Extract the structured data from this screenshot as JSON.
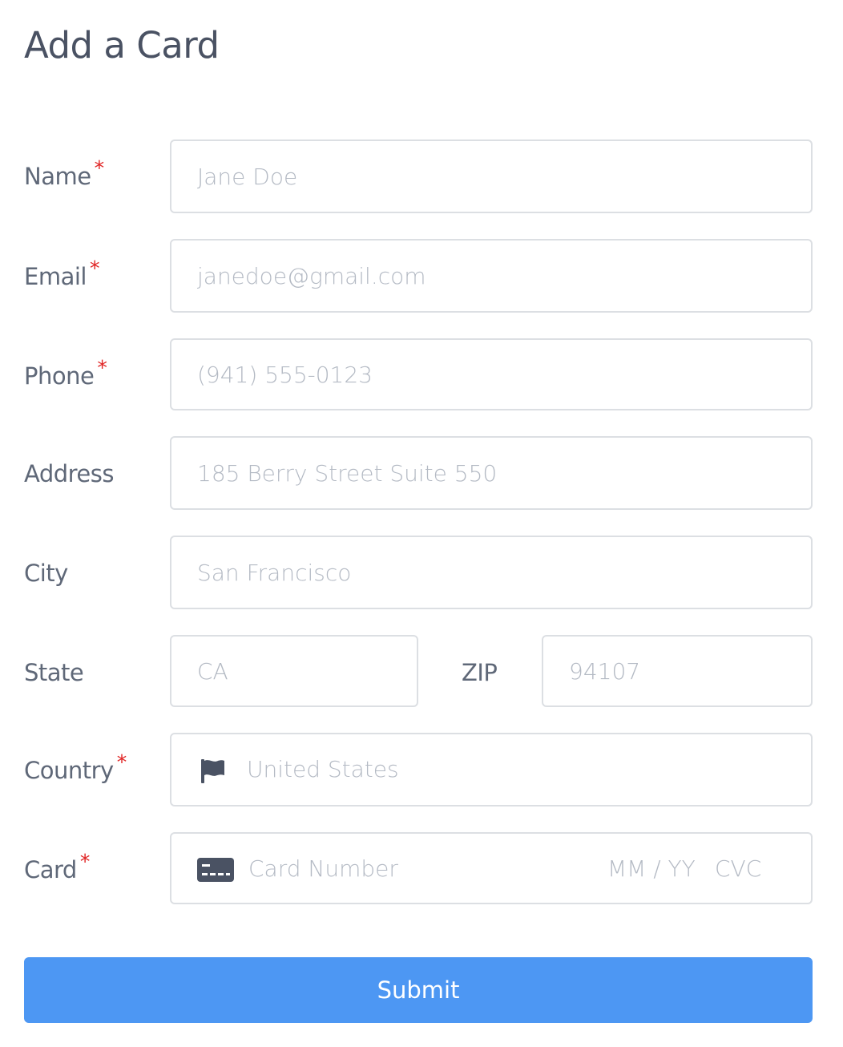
{
  "page": {
    "title": "Add a Card"
  },
  "colors": {
    "accent": "#4d97f3",
    "required": "#e02424",
    "label": "#5f6878",
    "placeholder": "#b4bac4",
    "border": "#dcdfe3",
    "icon": "#4a5263"
  },
  "required_marker": "*",
  "fields": {
    "name": {
      "label": "Name",
      "placeholder": "Jane Doe",
      "value": ""
    },
    "email": {
      "label": "Email",
      "placeholder": "janedoe@gmail.com",
      "value": ""
    },
    "phone": {
      "label": "Phone",
      "placeholder": "(941) 555-0123",
      "value": ""
    },
    "address": {
      "label": "Address",
      "placeholder": "185 Berry Street Suite 550",
      "value": ""
    },
    "city": {
      "label": "City",
      "placeholder": "San Francisco",
      "value": ""
    },
    "state": {
      "label": "State",
      "placeholder": "CA",
      "value": ""
    },
    "zip": {
      "label": "ZIP",
      "placeholder": "94107",
      "value": ""
    },
    "country": {
      "label": "Country",
      "value": "United States",
      "icon": "flag-icon"
    },
    "card": {
      "label": "Card",
      "number_placeholder": "Card Number",
      "expiry_placeholder": "MM / YY",
      "cvc_placeholder": "CVC",
      "icon": "credit-card-icon"
    }
  },
  "submit": {
    "label": "Submit"
  }
}
